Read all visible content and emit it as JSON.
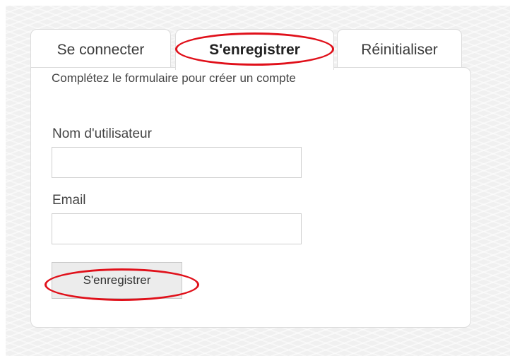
{
  "tabs": {
    "login_label": "Se connecter",
    "register_label": "S'enregistrer",
    "reset_label": "Réinitialiser",
    "active": "register"
  },
  "form": {
    "intro": "Complétez le formulaire pour créer un compte",
    "username_label": "Nom d'utilisateur",
    "username_value": "",
    "email_label": "Email",
    "email_value": "",
    "submit_label": "S'enregistrer"
  },
  "annotations": {
    "highlight_color": "#e0101a",
    "highlighted_items": [
      "register-tab",
      "register-button"
    ]
  }
}
